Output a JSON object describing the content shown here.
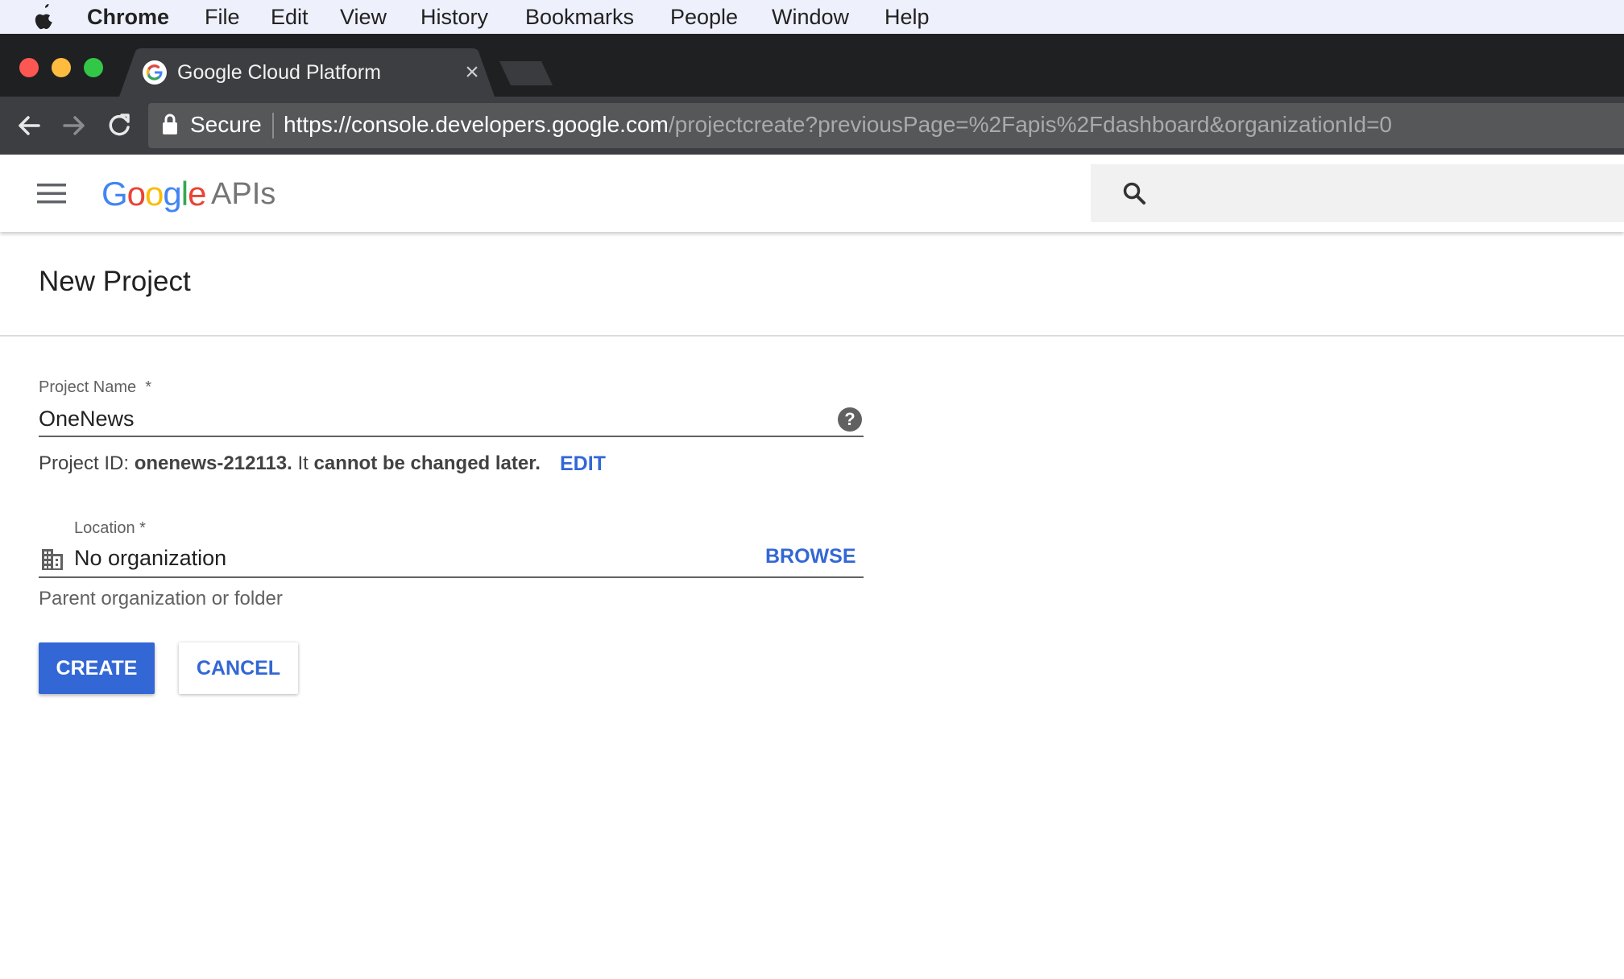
{
  "menubar": {
    "app_name": "Chrome",
    "items": [
      "File",
      "Edit",
      "View",
      "History",
      "Bookmarks",
      "People",
      "Window",
      "Help"
    ]
  },
  "browser": {
    "tab_title": "Google Cloud Platform",
    "tab_close": "×",
    "security_label": "Secure",
    "url_host": "https://console.developers.google.com",
    "url_path": "/projectcreate?previousPage=%2Fapis%2Fdashboard&organizationId=0"
  },
  "header": {
    "logo_text": "Google",
    "product": "APIs",
    "logo_colors": [
      "#4285f4",
      "#ea4335",
      "#fbbc05",
      "#4285f4",
      "#34a853",
      "#ea4335"
    ]
  },
  "form": {
    "title": "New Project",
    "project_name_label": "Project Name",
    "required_marker": "*",
    "project_name_value": "OneNews",
    "help_icon": "?",
    "project_id_prefix": "Project ID:",
    "project_id_value": "onenews-212113.",
    "project_id_middle": "It",
    "project_id_suffix": "cannot be changed later.",
    "edit_label": "EDIT",
    "location_label": "Location *",
    "location_value": "No organization",
    "browse_label": "BROWSE",
    "location_hint": "Parent organization or folder",
    "create_label": "CREATE",
    "cancel_label": "CANCEL"
  },
  "colors": {
    "accent": "#3367d6",
    "chrome_dark": "#1f2022",
    "chrome_toolbar": "#3d3e41",
    "menubar_bg": "#eef0fb"
  },
  "icons": [
    "apple-icon",
    "google-favicon-icon",
    "back-icon",
    "forward-icon",
    "reload-icon",
    "lock-icon",
    "menu-icon",
    "search-icon",
    "help-icon",
    "building-icon"
  ]
}
